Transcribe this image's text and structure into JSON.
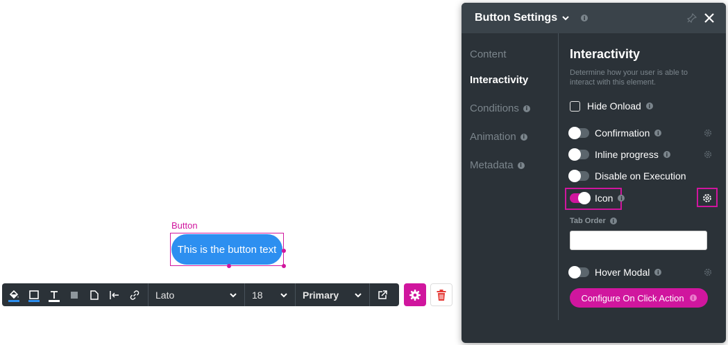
{
  "canvas": {
    "element_label": "Button",
    "button_text": "This is the button text"
  },
  "toolbar": {
    "font_family": "Lato",
    "font_size": "18",
    "style": "Primary",
    "underline_color": "#2d8ff0"
  },
  "panel": {
    "title": "Button Settings",
    "nav": [
      {
        "label": "Content",
        "active": false
      },
      {
        "label": "Interactivity",
        "active": true
      },
      {
        "label": "Conditions",
        "active": false
      },
      {
        "label": "Animation",
        "active": false
      },
      {
        "label": "Metadata",
        "active": false
      }
    ],
    "content": {
      "title": "Interactivity",
      "description": "Determine how your user is able to interact with this element.",
      "hide_onload": {
        "label": "Hide Onload",
        "checked": false
      },
      "confirmation": {
        "label": "Confirmation",
        "on": false
      },
      "inline_progress": {
        "label": "Inline progress",
        "on": false
      },
      "disable_on_execution": {
        "label": "Disable on Execution",
        "on": false
      },
      "icon": {
        "label": "Icon",
        "on": true
      },
      "tab_order": {
        "label": "Tab Order",
        "value": ""
      },
      "hover_modal": {
        "label": "Hover Modal",
        "on": false
      },
      "configure_button": "Configure On Click Action"
    }
  },
  "colors": {
    "accent": "#d0169e",
    "button_blue": "#2d8ff0",
    "panel_bg": "#2b3238",
    "panel_header": "#3a434a"
  }
}
